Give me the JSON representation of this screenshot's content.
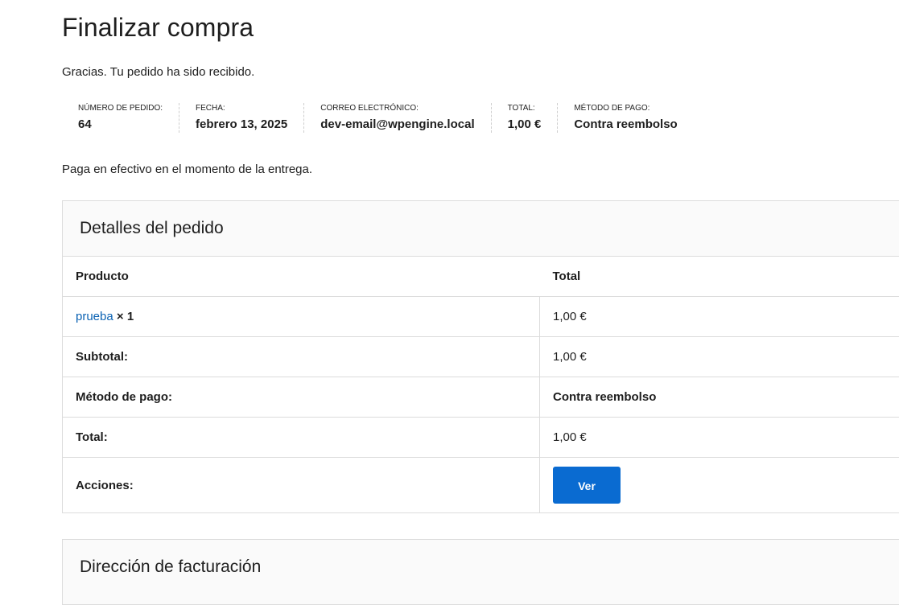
{
  "page": {
    "title": "Finalizar compra",
    "thanks": "Gracias. Tu pedido ha sido recibido.",
    "payment_note": "Paga en efectivo en el momento de la entrega."
  },
  "overview": [
    {
      "label": "NÚMERO DE PEDIDO:",
      "value": "64"
    },
    {
      "label": "FECHA:",
      "value": "febrero 13, 2025"
    },
    {
      "label": "CORREO ELECTRÓNICO:",
      "value": "dev-email@wpengine.local"
    },
    {
      "label": "TOTAL:",
      "value": "1,00 €"
    },
    {
      "label": "MÉTODO DE PAGO:",
      "value": "Contra reembolso"
    }
  ],
  "order_details": {
    "title": "Detalles del pedido",
    "headers": {
      "product": "Producto",
      "total": "Total"
    },
    "product": {
      "name": "prueba",
      "qty": "× 1",
      "total": "1,00 €"
    },
    "rows": [
      {
        "label": "Subtotal:",
        "value": "1,00 €"
      },
      {
        "label": "Método de pago:",
        "value": "Contra reembolso"
      },
      {
        "label": "Total:",
        "value": "1,00 €"
      }
    ],
    "actions_label": "Acciones:",
    "view_button": "Ver"
  },
  "billing": {
    "title": "Dirección de facturación"
  },
  "colors": {
    "link": "#0a62b3",
    "button": "#0a6bd1",
    "text": "#1e1e1e"
  }
}
